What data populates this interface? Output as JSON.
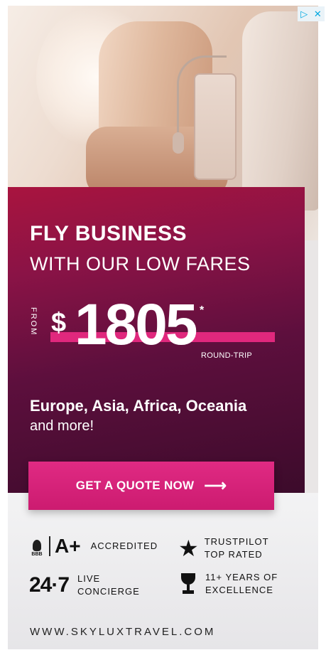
{
  "ad": {
    "headline_bold": "FLY BUSINESS",
    "headline_sub": "WITH OUR LOW FARES",
    "from_label": "FROM",
    "currency": "$",
    "price": "1805",
    "asterisk": "*",
    "price_note": "ROUND-TRIP",
    "destinations": "Europe, Asia, Africa, Oceania",
    "destinations_more": "and more!",
    "cta_label": "GET A QUOTE NOW",
    "cta_arrow": "⟶",
    "url": "WWW.SKYLUXTRAVEL.COM"
  },
  "badges": {
    "bbb_small": "BBB",
    "bbb_grade": "A+",
    "accredited": "ACCREDITED",
    "trustpilot_line1": "TRUSTPILOT",
    "trustpilot_line2": "TOP RATED",
    "support_mark": "24·7",
    "support_line1": "LIVE",
    "support_line2": "CONCIERGE",
    "years_line1": "11+ YEARS OF",
    "years_line2": "EXCELLENCE"
  },
  "adchoices": {
    "play": "▷",
    "close": "✕"
  },
  "colors": {
    "brand_pink": "#e0287d",
    "panel_dark": "#5d0f3d"
  }
}
